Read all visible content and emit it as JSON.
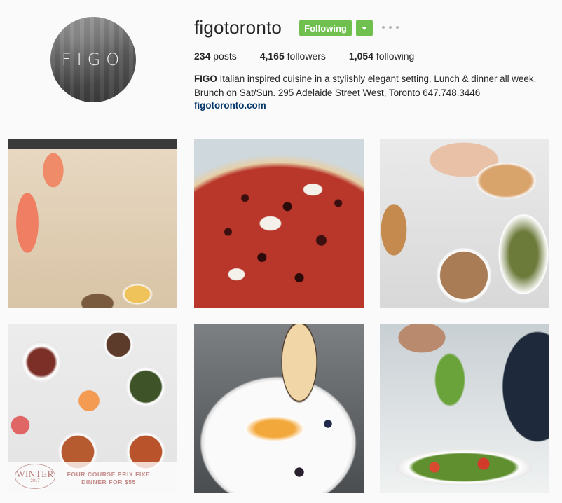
{
  "profile": {
    "avatar_text": "FIGO",
    "username": "figotoronto",
    "follow_button": "Following",
    "stats": {
      "posts_count": "234",
      "posts_label": "posts",
      "followers_count": "4,165",
      "followers_label": "followers",
      "following_count": "1,054",
      "following_label": "following"
    },
    "bio_name": "FIGO",
    "bio_line1": "Italian inspired cuisine in a stylishly elegant setting. Lunch & dinner all week.",
    "bio_line2": "Brunch on Sat/Sun. 295 Adelaide Street West, Toronto 647.748.3446",
    "website": "figotoronto.com"
  },
  "colors": {
    "follow_green": "#70c050",
    "link_blue": "#003569",
    "background": "#fafafa"
  },
  "posts": [
    {
      "subject": "cocktails-soup-bread"
    },
    {
      "subject": "pizza"
    },
    {
      "subject": "brunch-table"
    },
    {
      "subject": "winter-prix-fixe",
      "badge_word": "WINTER",
      "badge_year": "2017",
      "promo_line1": "FOUR COURSE PRIX FIXE",
      "promo_line2": "DINNER FOR $55"
    },
    {
      "subject": "plated-dish-crisp"
    },
    {
      "subject": "salad-toss"
    }
  ],
  "icons": {
    "more": "more-dots-icon",
    "dropdown": "chevron-down-icon"
  }
}
